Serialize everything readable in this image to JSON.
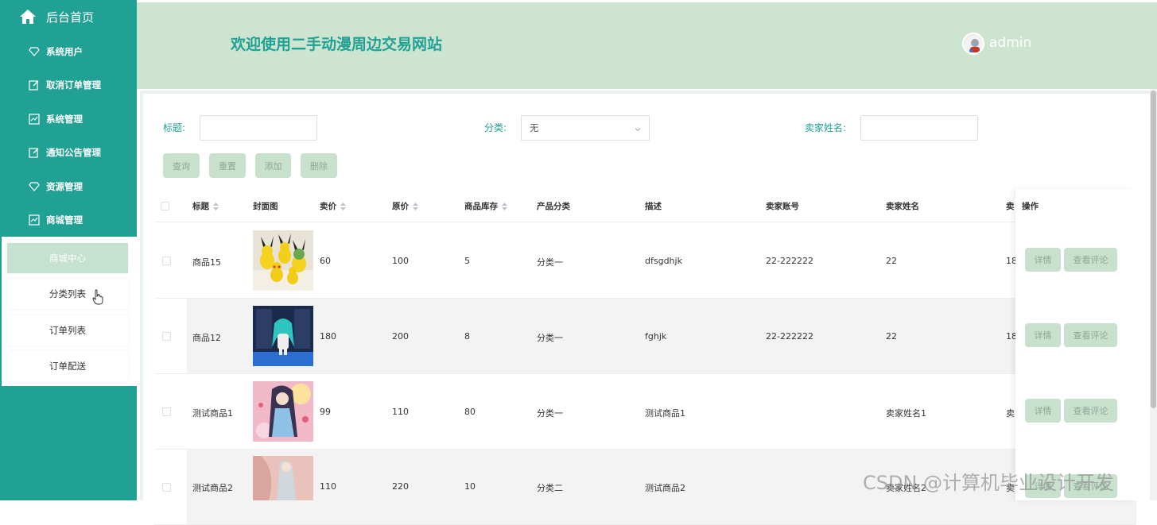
{
  "sidebar": {
    "home_label": "后台首页",
    "menu": [
      {
        "label": "系统用户",
        "icon": "diamond-icon"
      },
      {
        "label": "取消订单管理",
        "icon": "edit-icon"
      },
      {
        "label": "系统管理",
        "icon": "chart-icon"
      },
      {
        "label": "通知公告管理",
        "icon": "edit-icon"
      },
      {
        "label": "资源管理",
        "icon": "diamond-icon"
      },
      {
        "label": "商城管理",
        "icon": "chart-icon"
      }
    ],
    "submenu": [
      "商城中心",
      "分类列表",
      "订单列表",
      "订单配送"
    ],
    "active_submenu": "商城中心"
  },
  "header": {
    "title": "欢迎使用二手动漫周边交易网站",
    "user": "admin"
  },
  "filters": {
    "title_label": "标题:",
    "category_label": "分类:",
    "category_value": "无",
    "seller_label": "卖家姓名:"
  },
  "buttons": {
    "query": "查询",
    "reset": "重置",
    "add": "添加",
    "delete": "删除"
  },
  "table": {
    "headers": [
      "标题",
      "封面图",
      "卖价",
      "原价",
      "商品库存",
      "产品分类",
      "描述",
      "卖家账号",
      "卖家姓名",
      "卖",
      "操作"
    ],
    "rows": [
      {
        "title": "商品15",
        "price": "60",
        "original": "100",
        "stock": "5",
        "category": "分类一",
        "desc": "dfsgdhjk",
        "account": "22-222222",
        "seller": "22",
        "extra": "18"
      },
      {
        "title": "商品12",
        "price": "180",
        "original": "200",
        "stock": "8",
        "category": "分类一",
        "desc": "fghjk",
        "account": "22-222222",
        "seller": "22",
        "extra": "18"
      },
      {
        "title": "测试商品1",
        "price": "99",
        "original": "110",
        "stock": "80",
        "category": "分类一",
        "desc": "测试商品1",
        "account": "",
        "seller": "卖家姓名1",
        "extra": "卖"
      },
      {
        "title": "测试商品2",
        "price": "110",
        "original": "220",
        "stock": "10",
        "category": "分类二",
        "desc": "测试商品2",
        "account": "",
        "seller": "卖家姓名2",
        "extra": "卖"
      }
    ],
    "op_detail": "详情",
    "op_comment": "查看评论"
  },
  "watermark": "CSDN @计算机毕业设计开发",
  "colors": {
    "accent": "#21a194",
    "header_bg": "#cde4d0",
    "button_bg": "#c7e1cd"
  }
}
